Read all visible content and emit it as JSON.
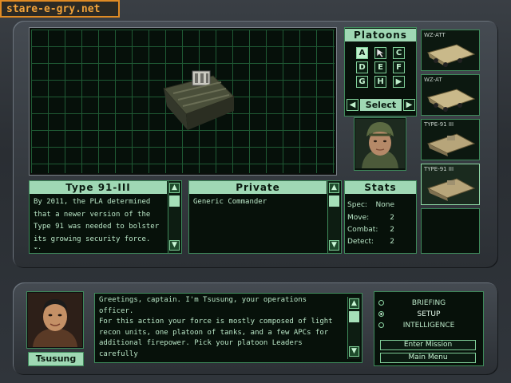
{
  "watermark": "stare-e-gry.net",
  "unit_panel": {
    "title": "Type 91-III",
    "description": "By 2011, the PLA determined that a newer version of the Type 91 was needed to bolster its growing security force. It"
  },
  "rank_panel": {
    "title": "Private",
    "text": "Generic Commander"
  },
  "platoons": {
    "title": "Platoons",
    "buttons": [
      "A",
      "C",
      "D",
      "E",
      "F",
      "G",
      "H"
    ],
    "select_label": "Select"
  },
  "stats": {
    "title": "Stats",
    "rows": [
      {
        "label": "Spec:",
        "value": "None"
      },
      {
        "label": "Move:",
        "value": "2"
      },
      {
        "label": "Combat:",
        "value": "2"
      },
      {
        "label": "Detect:",
        "value": "2"
      }
    ]
  },
  "units": [
    {
      "label": "WZ-ATT"
    },
    {
      "label": "WZ-AT"
    },
    {
      "label": "TYPE-91 III"
    },
    {
      "label": "TYPE-91 III"
    }
  ],
  "officer": {
    "name": "Tsusung",
    "message": "Greetings, captain.  I'm Tsusung, your operations officer.\nFor this action your force is mostly composed of light\nrecon units, one platoon of tanks, and a few APCs for\nadditional firepower.  Pick your platoon Leaders carefully\n- the right commander can make the difference between\nvictory and defeat."
  },
  "menu": {
    "items": [
      {
        "label": "BRIEFING",
        "selected": false
      },
      {
        "label": "SETUP",
        "selected": true
      },
      {
        "label": "INTELLIGENCE",
        "selected": false
      }
    ],
    "enter_label": "Enter Mission",
    "main_label": "Main Menu"
  },
  "colors": {
    "accent": "#9fd8b4",
    "border": "#3e8a5a",
    "text": "#b9e6c6"
  }
}
